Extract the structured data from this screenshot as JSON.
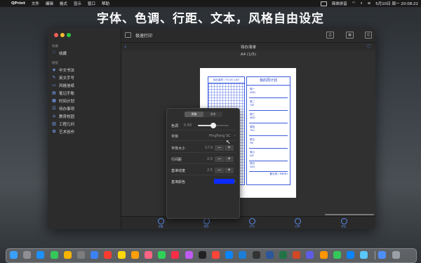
{
  "menubar": {
    "apple": "",
    "app_name": "QPrint",
    "menus": [
      "文件",
      "编辑",
      "格式",
      "显示",
      "窗口",
      "帮助"
    ],
    "input_method": "简体拼音",
    "date_time": "5月10日 周一  20:08:22"
  },
  "headline": "字体、色调、行距、文本，风格自由设定",
  "window": {
    "toolbar_title": "极速打印",
    "page_title": "待办清单",
    "page_size": "A4 (1/5)"
  },
  "sidebar": {
    "favorites_heading": "收藏",
    "favorites": [
      {
        "label": "收藏",
        "icon": "heart-icon"
      }
    ],
    "templates_heading": "模版",
    "items": [
      {
        "label": "中文书法",
        "icon": "brush-icon"
      },
      {
        "label": "英文手写",
        "icon": "pen-icon"
      },
      {
        "label": "风格信纸",
        "icon": "letter-icon"
      },
      {
        "label": "笔记手账",
        "icon": "notebook-icon"
      },
      {
        "label": "时间计划",
        "icon": "calendar-icon"
      },
      {
        "label": "待办事项",
        "icon": "checklist-icon"
      },
      {
        "label": "教育校园",
        "icon": "school-icon"
      },
      {
        "label": "工程几何",
        "icon": "ruler-icon"
      },
      {
        "label": "艺术创作",
        "icon": "palette-icon"
      }
    ]
  },
  "paper": {
    "todo_header": "待办事项 / TO DO LIST",
    "plan_title": "我的周计划",
    "days": [
      {
        "cn": "周一",
        "en": "MON"
      },
      {
        "cn": "周二",
        "en": "TUE"
      },
      {
        "cn": "周三",
        "en": "WED"
      },
      {
        "cn": "周四",
        "en": "THU"
      },
      {
        "cn": "周五",
        "en": "FRI"
      },
      {
        "cn": "周六",
        "en": "SAT"
      },
      {
        "cn": "周日",
        "en": "SUN"
      }
    ],
    "memo": "备忘录 / MEMO"
  },
  "popover": {
    "segments": [
      "风格",
      "文本"
    ],
    "active_segment": 0,
    "tone": {
      "label": "色调",
      "value": "0.50",
      "fraction": 0.5
    },
    "font": {
      "label": "字体",
      "value": "PingFang SC"
    },
    "font_size": {
      "label": "字体大小",
      "value": "17.0"
    },
    "line_spacing": {
      "label": "行间距",
      "value": "2.0"
    },
    "line_thickness": {
      "label": "基准线宽",
      "value": "2.5"
    },
    "line_color": {
      "label": "基准颜色",
      "color": "#0b2bff"
    },
    "minus": "−",
    "plus": "+",
    "chevron": "›"
  },
  "tabbar": {
    "tabs": [
      "设置",
      "预览",
      "打印",
      "分享",
      "导出"
    ]
  },
  "colors": {
    "accent": "#5b8def",
    "paper_blue": "#3b5bdb",
    "close": "#ff5f57",
    "minimize": "#febc2e",
    "zoom": "#28c840"
  },
  "dock": {
    "icons": [
      "finder-icon",
      "launchpad-icon",
      "safari-icon",
      "messages-icon",
      "chrome-icon",
      "settings-icon",
      "mail-icon",
      "calendar-icon",
      "notes-icon",
      "reminders-icon",
      "photos-icon",
      "maps-icon",
      "music-icon",
      "podcasts-icon",
      "tv-icon",
      "news-icon",
      "appstore-icon",
      "xcode-icon",
      "terminal-icon",
      "word-icon",
      "excel-icon",
      "ppt-icon",
      "qprint-icon",
      "pages-icon",
      "numbers-icon",
      "keynote-icon",
      "preview-icon",
      "downloads-icon",
      "trash-icon"
    ]
  }
}
